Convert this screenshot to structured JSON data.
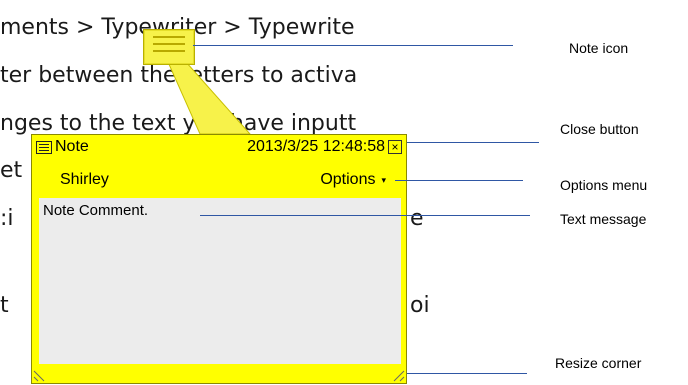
{
  "document": {
    "lines": [
      "ments > Typewriter > Typewrite",
      "ter between the letters to activa",
      "nges to the text you have inputt",
      "et",
      ":i",
      "e",
      "t",
      "oi"
    ]
  },
  "note": {
    "type_label": "Note",
    "timestamp": "2013/3/25 12:48:58",
    "author": "Shirley",
    "options_label": "Options",
    "comment": "Note Comment.",
    "close_glyph": "×",
    "options_glyph": "▾",
    "background_color": "#ffff00"
  },
  "callouts": {
    "note_icon": "Note icon",
    "close_button": "Close button",
    "options_menu": "Options  menu",
    "text_message": "Text message",
    "resize_corner": "Resize corner"
  }
}
